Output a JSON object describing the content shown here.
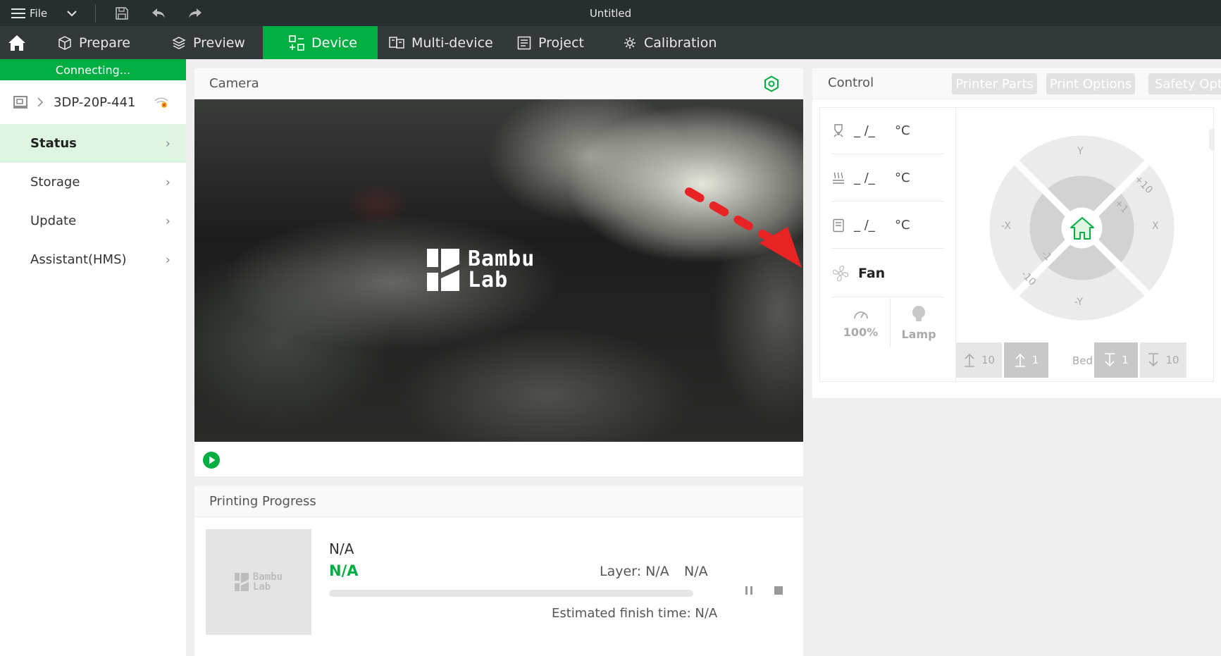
{
  "titlebar": {
    "file_label": "File",
    "window_title": "Untitled"
  },
  "tabs": [
    {
      "label": "Prepare",
      "icon": "cube-icon"
    },
    {
      "label": "Preview",
      "icon": "layers-icon"
    },
    {
      "label": "Device",
      "icon": "device-icon",
      "active": true
    },
    {
      "label": "Multi-device",
      "icon": "multi-device-icon"
    },
    {
      "label": "Project",
      "icon": "project-icon"
    },
    {
      "label": "Calibration",
      "icon": "calibration-icon"
    }
  ],
  "sidebar": {
    "status_banner": "Connecting...",
    "device_name": "3DP-20P-441",
    "items": [
      {
        "label": "Status",
        "active": true
      },
      {
        "label": "Storage"
      },
      {
        "label": "Update"
      },
      {
        "label": "Assistant(HMS)"
      }
    ]
  },
  "camera": {
    "title": "Camera",
    "logo_line1": "Bambu",
    "logo_line2": "Lab"
  },
  "progress": {
    "title": "Printing Progress",
    "thumb_logo_line1": "Bambu",
    "thumb_logo_line2": "Lab",
    "task_name": "N/A",
    "percent": "N/A",
    "layer": "Layer: N/A",
    "remaining": "N/A",
    "estimated_finish": "Estimated finish time: N/A",
    "progress_fraction": 0
  },
  "control": {
    "title": "Control",
    "buttons": [
      "Printer Parts",
      "Print Options",
      "Safety Opti"
    ],
    "temps": [
      {
        "icon": "nozzle-icon",
        "value": "_ /_",
        "unit": "°C"
      },
      {
        "icon": "heatbed-icon",
        "value": "_ /_",
        "unit": "°C"
      },
      {
        "icon": "chamber-icon",
        "value": "_ /_",
        "unit": "°C"
      }
    ],
    "fan_label": "Fan",
    "speed_label": "100%",
    "lamp_label": "Lamp",
    "jog": {
      "y_plus": "Y",
      "y_minus": "-Y",
      "x_plus": "X",
      "x_minus": "-X",
      "plus10": "+10",
      "plus1": "+1",
      "minus1": "-1",
      "minus10": "-10"
    },
    "bed_buttons": {
      "up10": "10",
      "up1": "1",
      "label": "Bed",
      "down1": "1",
      "down10": "10"
    }
  },
  "colors": {
    "accent": "#00ae42",
    "annotation_arrow": "#e82323"
  }
}
